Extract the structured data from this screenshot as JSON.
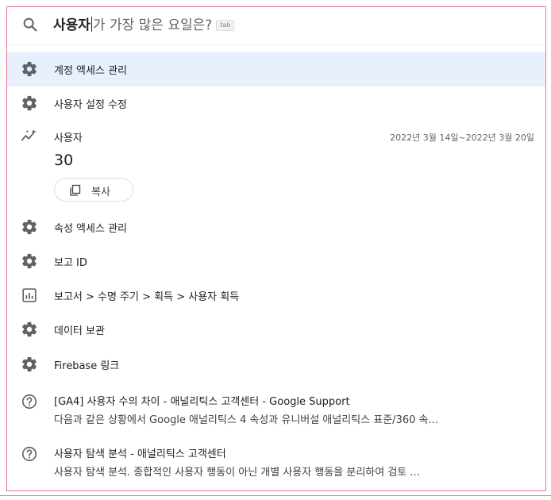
{
  "search": {
    "typed": "사용자",
    "suggestion": "가 가장 많은 요일은?",
    "tab_hint": "tab"
  },
  "items": [
    {
      "label": "계정 액세스 관리",
      "icon": "gear-icon"
    },
    {
      "label": "사용자 설정 수정",
      "icon": "gear-icon"
    },
    {
      "label": "속성 액세스 관리",
      "icon": "gear-icon"
    },
    {
      "label": "보고 ID",
      "icon": "gear-icon"
    },
    {
      "label": "보고서 > 수명 주기 > 획득 > 사용자 획득",
      "icon": "report-icon"
    },
    {
      "label": "데이터 보관",
      "icon": "gear-icon"
    },
    {
      "label": "Firebase 링크",
      "icon": "gear-icon"
    }
  ],
  "insight": {
    "label": "사용자",
    "date_range": "2022년 3월 14일~2022년 3월 20일",
    "value": "30",
    "copy_label": "복사",
    "icon": "insights-sparkle-icon"
  },
  "results": [
    {
      "title": "[GA4] 사용자 수의 차이 - 애널리틱스 고객센터 - Google Support",
      "snippet": "다음과 같은 상황에서 Google 애널리틱스 4 속성과 유니버설 애널리틱스 표준/360 속...",
      "icon": "help-circle-icon"
    },
    {
      "title": "사용자 탐색 분석 - 애널리틱스 고객센터",
      "snippet": "사용자 탐색 분석. 종합적인 사용자 행동이 아닌 개별 사용자 행동을 분리하여 검토 ...",
      "icon": "help-circle-icon"
    }
  ],
  "colors": {
    "selected_bg": "#e8f0fe",
    "icon": "#5f6368",
    "panel_border": "#e8738f"
  }
}
